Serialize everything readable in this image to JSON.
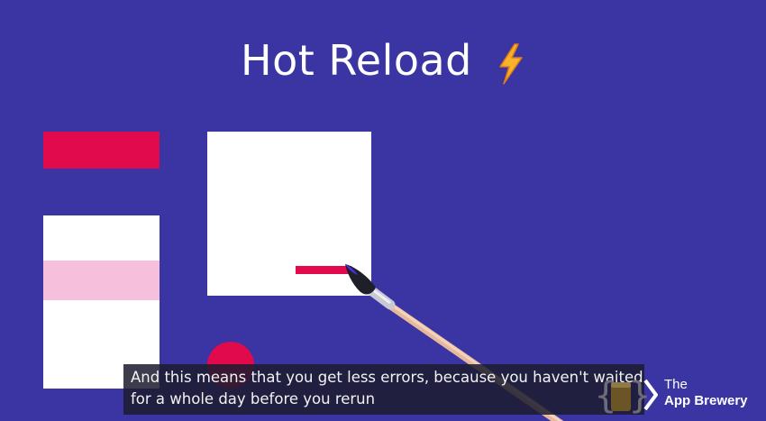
{
  "slide": {
    "title": "Hot Reload",
    "title_emoji": "lightning-bolt",
    "colors": {
      "background": "#3a35a3",
      "accent": "#e10a4c",
      "pink": "#f6bfdb",
      "white": "#ffffff"
    }
  },
  "caption": {
    "line1": "And this means that you get less errors, because you haven't waited",
    "line2": "for a whole day before you rerun"
  },
  "logo": {
    "line1": "The",
    "line2": "App Brewery"
  }
}
